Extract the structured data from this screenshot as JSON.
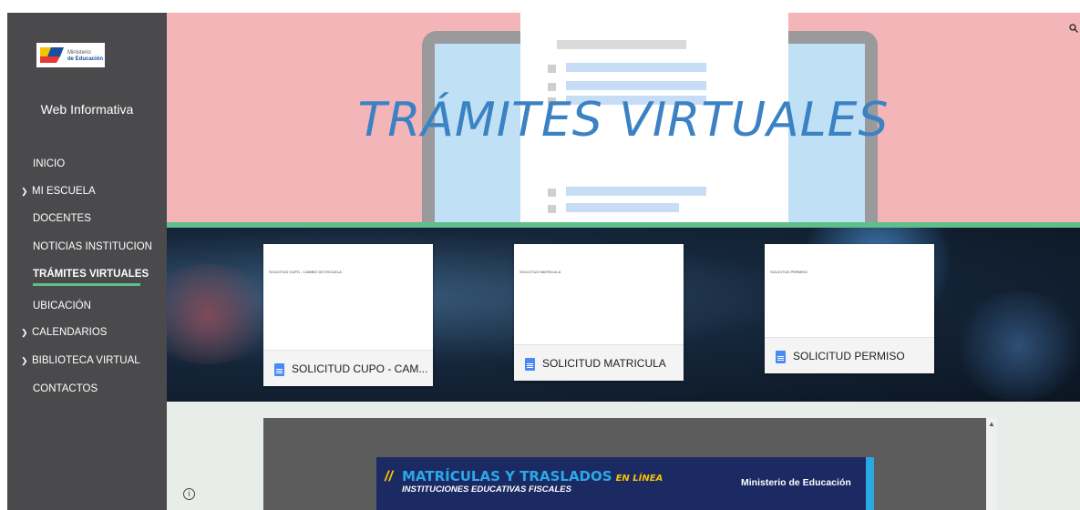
{
  "sidebar": {
    "logo_text_1": "Ministerio",
    "logo_text_2": "de Educación",
    "site_title": "Web Informativa",
    "nav": [
      {
        "label": "INICIO"
      },
      {
        "label": "MI ESCUELA"
      },
      {
        "label": "DOCENTES"
      },
      {
        "label": "NOTICIAS INSTITUCION"
      },
      {
        "label": "TRÁMITES VIRTUALES"
      },
      {
        "label": "UBICACIÓN"
      },
      {
        "label": "CALENDARIOS"
      },
      {
        "label": "BIBLIOTECA VIRTUAL"
      },
      {
        "label": "CONTACTOS"
      }
    ],
    "active_color": "#5fbf8a"
  },
  "hero": {
    "title": "TRÁMITES VIRTUALES",
    "title_color": "#3b82c4"
  },
  "cards": [
    {
      "preview": "SOLICITUD CUPO - CAMBIO DE ESCUELA",
      "label": "SOLICITUD CUPO - CAM..."
    },
    {
      "preview": "SOLICITUD MATRICULA",
      "label": "SOLICITUD MATRICULA"
    },
    {
      "preview": "SOLICITUD PERMISO",
      "label": "SOLICITUD PERMISO"
    }
  ],
  "banner": {
    "slash": "//",
    "title_main": "MATRÍCULAS Y TRASLADOS",
    "title_tail": "EN LÍNEA",
    "subtitle": "INSTITUCIONES EDUCATIVAS FISCALES",
    "ministry": "Ministerio de Educación"
  },
  "icons": {
    "search": "search-icon",
    "info": "info-icon",
    "doc": "google-docs-icon",
    "chevron": "chevron-down-icon"
  }
}
